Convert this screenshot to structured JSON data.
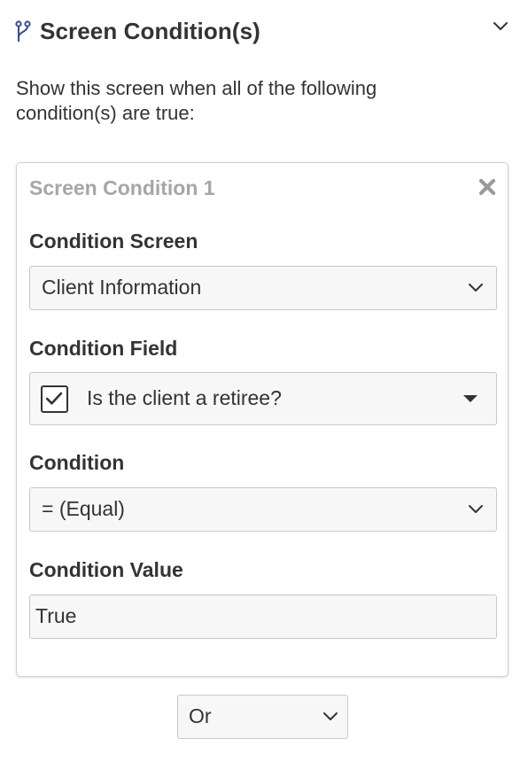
{
  "section": {
    "title": "Screen Condition(s)",
    "icon": "branch-icon",
    "collapse_icon": "chevron-down-icon"
  },
  "intro_text": "Show this screen when all of the following condition(s) are true:",
  "condition_card": {
    "title": "Screen Condition 1",
    "close_icon": "close-icon",
    "screen": {
      "label": "Condition Screen",
      "value": "Client Information"
    },
    "field": {
      "label": "Condition Field",
      "value": "Is the client a retiree?",
      "checkbox_icon": "checkbox-checked-icon"
    },
    "condition": {
      "label": "Condition",
      "value": "= (Equal)"
    },
    "condition_value": {
      "label": "Condition Value",
      "value": "True"
    }
  },
  "logic_operator": {
    "value": "Or"
  },
  "colors": {
    "icon_blue": "#3d4a8c",
    "card_border": "#cfcfcf",
    "muted_title": "#a6a6a6",
    "field_bg": "#f7f7f7"
  }
}
